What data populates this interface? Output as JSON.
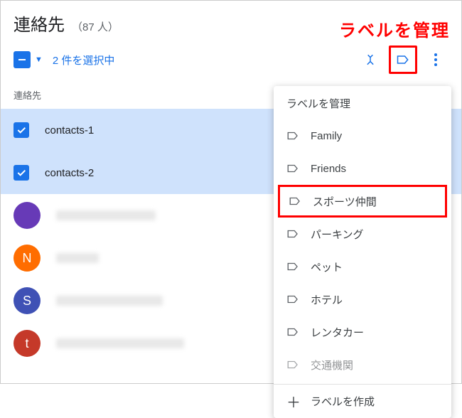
{
  "header": {
    "title": "連絡先",
    "count": "（87 人）"
  },
  "annotation": "ラベルを管理",
  "toolbar": {
    "selection_text": "2 件を選択中"
  },
  "section": {
    "label": "連絡先"
  },
  "contacts": {
    "selected": [
      {
        "name": "contacts-1"
      },
      {
        "name": "contacts-2"
      }
    ],
    "others": [
      {
        "avatar_letter": "",
        "avatar_class": "av-purple",
        "blur_class": "w1"
      },
      {
        "avatar_letter": "N",
        "avatar_class": "av-orange",
        "blur_class": "w2"
      },
      {
        "avatar_letter": "S",
        "avatar_class": "av-blue",
        "blur_class": "w3"
      },
      {
        "avatar_letter": "t",
        "avatar_class": "av-red",
        "blur_class": "w5"
      }
    ]
  },
  "popover": {
    "title": "ラベルを管理",
    "labels": [
      {
        "text": "Family"
      },
      {
        "text": "Friends"
      },
      {
        "text": "スポーツ仲間",
        "highlight": true
      },
      {
        "text": "パーキング"
      },
      {
        "text": "ペット"
      },
      {
        "text": "ホテル"
      },
      {
        "text": "レンタカー"
      },
      {
        "text": "交通機関",
        "partial": true
      }
    ],
    "create": "ラベルを作成"
  }
}
